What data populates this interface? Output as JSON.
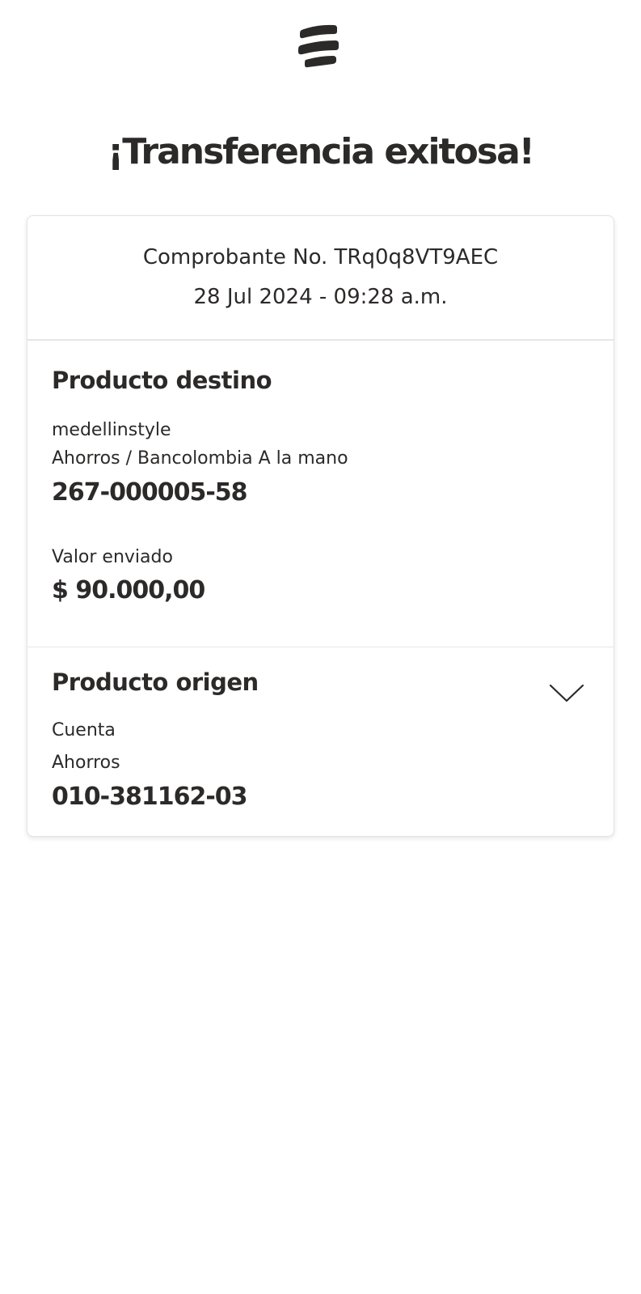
{
  "header": {
    "logo_icon": "bancolombia-logo-icon",
    "title": "¡Transferencia exitosa!"
  },
  "receipt": {
    "number_line": "Comprobante No. TRq0q8VT9AEC",
    "datetime": "28 Jul 2024 - 09:28 a.m."
  },
  "destination": {
    "title": "Producto destino",
    "name": "medellinstyle",
    "account_type": "Ahorros / Bancolombia A la mano",
    "account_number": "267-000005-58",
    "amount_label": "Valor enviado",
    "amount": "$ 90.000,00"
  },
  "origin": {
    "title": "Producto origen",
    "expand_icon": "chevron-down-icon",
    "label": "Cuenta",
    "account_type": "Ahorros",
    "account_number": "010-381162-03"
  },
  "colors": {
    "text": "#2c2a29",
    "card_border": "#e3e3e3",
    "background": "#ffffff"
  }
}
